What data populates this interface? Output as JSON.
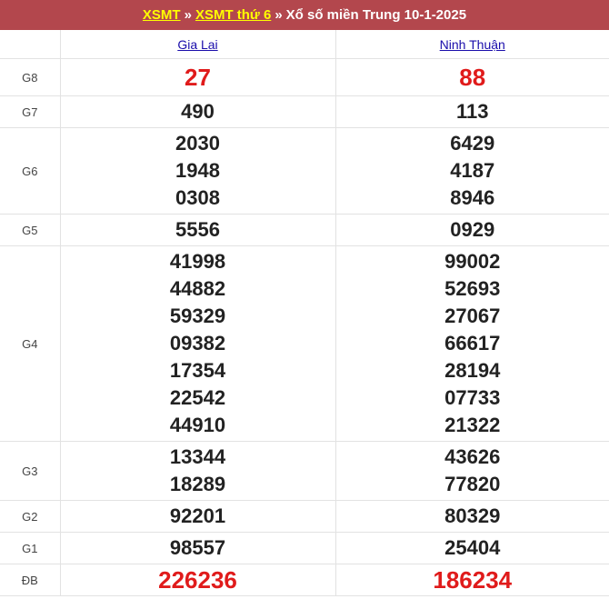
{
  "header": {
    "link1": "XSMT",
    "sep1": "»",
    "link2": "XSMT thứ 6",
    "sep2": "»",
    "title": "Xổ số miền Trung 10-1-2025"
  },
  "columns": {
    "province1": "Gia Lai",
    "province2": "Ninh Thuận"
  },
  "prizes": {
    "g8": {
      "label": "G8",
      "p1": [
        "27"
      ],
      "p2": [
        "88"
      ]
    },
    "g7": {
      "label": "G7",
      "p1": [
        "490"
      ],
      "p2": [
        "113"
      ]
    },
    "g6": {
      "label": "G6",
      "p1": [
        "2030",
        "1948",
        "0308"
      ],
      "p2": [
        "6429",
        "4187",
        "8946"
      ]
    },
    "g5": {
      "label": "G5",
      "p1": [
        "5556"
      ],
      "p2": [
        "0929"
      ]
    },
    "g4": {
      "label": "G4",
      "p1": [
        "41998",
        "44882",
        "59329",
        "09382",
        "17354",
        "22542",
        "44910"
      ],
      "p2": [
        "99002",
        "52693",
        "27067",
        "66617",
        "28194",
        "07733",
        "21322"
      ]
    },
    "g3": {
      "label": "G3",
      "p1": [
        "13344",
        "18289"
      ],
      "p2": [
        "43626",
        "77820"
      ]
    },
    "g2": {
      "label": "G2",
      "p1": [
        "92201"
      ],
      "p2": [
        "80329"
      ]
    },
    "g1": {
      "label": "G1",
      "p1": [
        "98557"
      ],
      "p2": [
        "25404"
      ]
    },
    "db": {
      "label": "ĐB",
      "p1": [
        "226236"
      ],
      "p2": [
        "186234"
      ]
    }
  },
  "colors": {
    "header_bg": "#b3474d",
    "header_link": "#ffff00",
    "highlight": "#e01b1b",
    "link": "#1a0dab"
  }
}
